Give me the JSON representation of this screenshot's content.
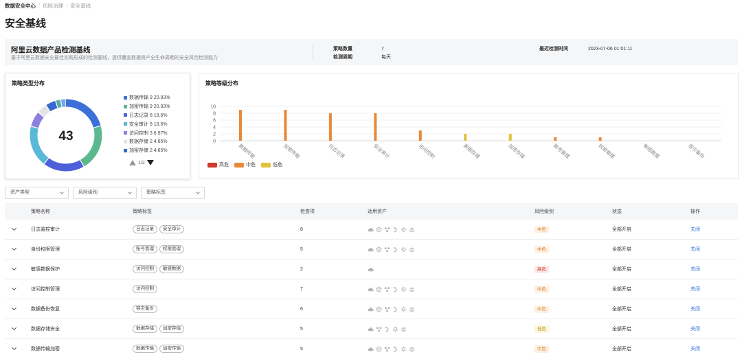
{
  "breadcrumb": [
    "数据安全中心",
    "风险治理",
    "安全基线"
  ],
  "page_title": "安全基线",
  "summary": {
    "name": "阿里云数据产品检测基线",
    "desc": "基于阿里云数据安全最佳实践形成的检测基线，提供覆盖数据资产全生命周期的安全风险检测能力",
    "policy_count_label": "策略数量",
    "policy_count": "7",
    "cycle_label": "检测周期",
    "cycle": "每天",
    "last_check_label": "最近检测时间",
    "last_check": "2023-07-06 01:01:11"
  },
  "donut_card": {
    "title": "策略类型分布",
    "total": "43",
    "legend": [
      {
        "label": "数据传输 9 20.93%",
        "value": 9,
        "color": "#3d6fd9"
      },
      {
        "label": "加密传输 9 20.93%",
        "value": 9,
        "color": "#5cb88f"
      },
      {
        "label": "日志记录 8 18.6%",
        "value": 8,
        "color": "#4d5fd8"
      },
      {
        "label": "安全审计 8 18.6%",
        "value": 8,
        "color": "#5ab8d8"
      },
      {
        "label": "访问控制 3 6.97%",
        "value": 3,
        "color": "#8c7fe0"
      },
      {
        "label": "数据存储 2 4.65%",
        "value": 2,
        "color": "#e3e3e3"
      },
      {
        "label": "加密存储 2 4.65%",
        "value": 2,
        "color": "#3a68d0"
      },
      {
        "label": "",
        "value": 1,
        "color": "#4fb0a0"
      },
      {
        "label": "",
        "value": 1,
        "color": "#7ea3e8"
      }
    ],
    "pager": "1/2"
  },
  "level_card": {
    "title": "策略等级分布"
  },
  "chart_data": {
    "type": "bar",
    "categories": [
      "数据传输",
      "加密传输",
      "日志记录",
      "安全审计",
      "访问控制",
      "数据存储",
      "加密存储",
      "账号管理",
      "权限管理",
      "敏感数据",
      "容灾备份"
    ],
    "series": [
      {
        "name": "高危",
        "color": "#d0392b",
        "values": [
          0,
          0,
          0,
          0,
          0,
          0,
          0,
          0,
          0,
          0,
          0
        ]
      },
      {
        "name": "中危",
        "color": "#e8893a",
        "values": [
          9,
          9,
          8,
          8,
          3,
          0,
          0,
          1,
          1,
          0,
          0
        ]
      },
      {
        "name": "低危",
        "color": "#e0c23c",
        "values": [
          0,
          0,
          0,
          0,
          0,
          2,
          2,
          0,
          0,
          0,
          0
        ]
      }
    ],
    "y_ticks": [
      "0",
      "2",
      "4",
      "6",
      "8",
      "10"
    ],
    "ylim": [
      0,
      10
    ],
    "legend_position": "bottom-left",
    "grid": true
  },
  "filters": [
    "资产类型",
    "风险级别",
    "策略标签"
  ],
  "table": {
    "headers": [
      "策略名称",
      "策略标签",
      "检查项",
      "适用资产",
      "风险级别",
      "状态",
      "操作"
    ],
    "rows": [
      {
        "name": "日志监控审计",
        "tags": [
          "日志记录",
          "安全审计"
        ],
        "checks": "8",
        "assets": [
          "cloud-icon",
          "cube-icon",
          "cluster-icon",
          "hook-icon",
          "gear-icon",
          "layers-icon"
        ],
        "risk": "中危",
        "status": "全部开启",
        "op": "关闭"
      },
      {
        "name": "身份权限管理",
        "tags": [
          "账号管理",
          "权限管理"
        ],
        "checks": "5",
        "assets": [
          "cloud-icon",
          "cube-icon",
          "cluster-icon",
          "hook-icon",
          "gear-icon",
          "layers-icon"
        ],
        "risk": "中危",
        "status": "全部开启",
        "op": "关闭"
      },
      {
        "name": "敏感数据保护",
        "tags": [
          "访问控制",
          "敏感数据"
        ],
        "checks": "2",
        "assets": [
          "cloud-icon"
        ],
        "risk": "高危",
        "status": "全部开启",
        "op": "关闭"
      },
      {
        "name": "访问控制管理",
        "tags": [
          "访问控制"
        ],
        "checks": "7",
        "assets": [
          "cloud-icon",
          "cube-icon",
          "cluster-icon",
          "hook-icon",
          "gear-icon",
          "layers-icon"
        ],
        "risk": "中危",
        "status": "全部开启",
        "op": "关闭"
      },
      {
        "name": "数据备份恢复",
        "tags": [
          "容灾备份"
        ],
        "checks": "6",
        "assets": [
          "cloud-icon",
          "cube-icon",
          "cluster-icon",
          "hook-icon",
          "gear-icon",
          "layers-icon"
        ],
        "risk": "中危",
        "status": "全部开启",
        "op": "关闭"
      },
      {
        "name": "数据存储安全",
        "tags": [
          "数据存储",
          "加密存储"
        ],
        "checks": "5",
        "assets": [
          "cloud-icon",
          "cluster-icon",
          "hook-icon",
          "gear-icon",
          "layers-icon"
        ],
        "risk": "低危",
        "status": "全部开启",
        "op": "关闭"
      },
      {
        "name": "数据传输加密",
        "tags": [
          "数据传输",
          "加密传输"
        ],
        "checks": "5",
        "assets": [
          "cloud-icon",
          "cube-icon",
          "cluster-icon",
          "hook-icon",
          "gear-icon",
          "layers-icon"
        ],
        "risk": "中危",
        "status": "全部开启",
        "op": "关闭"
      }
    ]
  },
  "risk_styles": {
    "高危": {
      "bg": "#fde8e6",
      "fg": "#d0392b"
    },
    "中危": {
      "bg": "#fdf0e3",
      "fg": "#d9822b"
    },
    "低危": {
      "bg": "#fcf6dc",
      "fg": "#b99a1c"
    }
  }
}
